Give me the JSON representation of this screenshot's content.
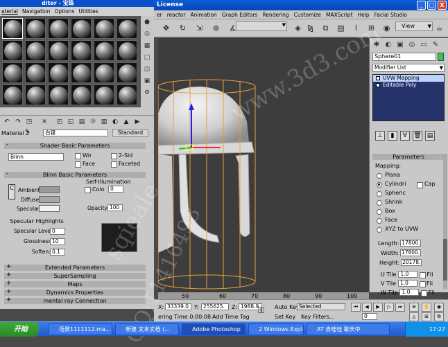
{
  "max_window": {
    "title": "License",
    "controls": [
      "_",
      "□",
      "X"
    ],
    "menu": [
      "er",
      "reactor",
      "Animation",
      "Graph Editors",
      "Rendering",
      "Customize",
      "MAXScript",
      "Help",
      "Facial Studio"
    ],
    "view_dropdown": "View"
  },
  "command_panel": {
    "object_name": "Sphere01",
    "object_color": "#2fc85a",
    "modifier_list": "Modifier List",
    "stack": [
      {
        "label": "UVW Mapping",
        "selected": true
      },
      {
        "label": "Editable Poly",
        "selected": false
      }
    ],
    "parameters_title": "Parameters",
    "mapping_label": "Mapping:",
    "mapping_options": [
      "Plana",
      "Cylindri",
      "Spheric",
      "Shrink",
      "Box",
      "Face",
      "XYZ to UVW"
    ],
    "mapping_selected": "Cylindri",
    "cap_label": "Cap",
    "length_label": "Length:",
    "length_value": "17800.",
    "width_label": "Width:",
    "width_value": "17800.",
    "height_label": "Height:",
    "height_value": "20178.",
    "u_tile_label": "U Tile",
    "u_tile_value": "1.0",
    "v_tile_label": "V Tile",
    "v_tile_value": "1.0",
    "w_tile_label": "W Tile",
    "w_tile_value": "1.0",
    "flip_label": "Fli",
    "channel_label": "Channel:"
  },
  "material_editor": {
    "title": "ditor - 宝珠",
    "menu": [
      "aterial",
      "Navigation",
      "Options",
      "Utilities"
    ],
    "material_label": "Material 2",
    "material_name": "白银",
    "material_type": "Standard",
    "shader_rollout": "Shader Basic Parameters",
    "shader_type": "Blinn",
    "wire_label": "Wir",
    "two_sided_label": "2-Sid",
    "face_map_label": "Face",
    "faceted_label": "Faceted",
    "blinn_rollout": "Blinn Basic Parameters",
    "self_illum_label": "Self-Illumination",
    "color_label": "Colo",
    "color_value": "0",
    "ambient_label": "Ambient:",
    "diffuse_label": "Diffuse:",
    "specular_label": "Specular:",
    "opacity_label": "Opacity:",
    "opacity_value": "100",
    "spec_highlights_label": "Specular Highlights",
    "spec_level_label": "Specular Level:",
    "spec_level_value": "0",
    "glossiness_label": "Glossiness:",
    "glossiness_value": "10",
    "soften_label": "Soften:",
    "soften_value": "0.1",
    "rollouts": [
      "Extended Parameters",
      "SuperSampling",
      "Maps",
      "Dynamics Properties",
      "mental ray Connection"
    ]
  },
  "timeline": {
    "ticks": [
      "50",
      "60",
      "70",
      "80",
      "90",
      "100"
    ],
    "x_label": "X:",
    "x_value": "33339.0",
    "y_label": "Y:",
    "y_value": "255625.",
    "z_label": "Z:",
    "z_value": "1988.9",
    "auto_key": "Auto Key",
    "selected": "Selected",
    "set_key": "Set Key",
    "key_filters": "Key Filters...",
    "rendering_time": "ering Time  0:00:08",
    "add_time_tag": "Add Time Tag",
    "frame_value": "0"
  },
  "taskbar": {
    "start": "开始",
    "tasks": [
      "场景1111112.ma...",
      "新建 文本文档 (...",
      "Adobe Photoshop",
      "2 Windows Expl...",
      "AT 去哇哇 聊天中"
    ],
    "clock": "17:27"
  },
  "watermarks": [
    "www.3d3.com",
    "sqieale",
    "QQ:11416493"
  ]
}
